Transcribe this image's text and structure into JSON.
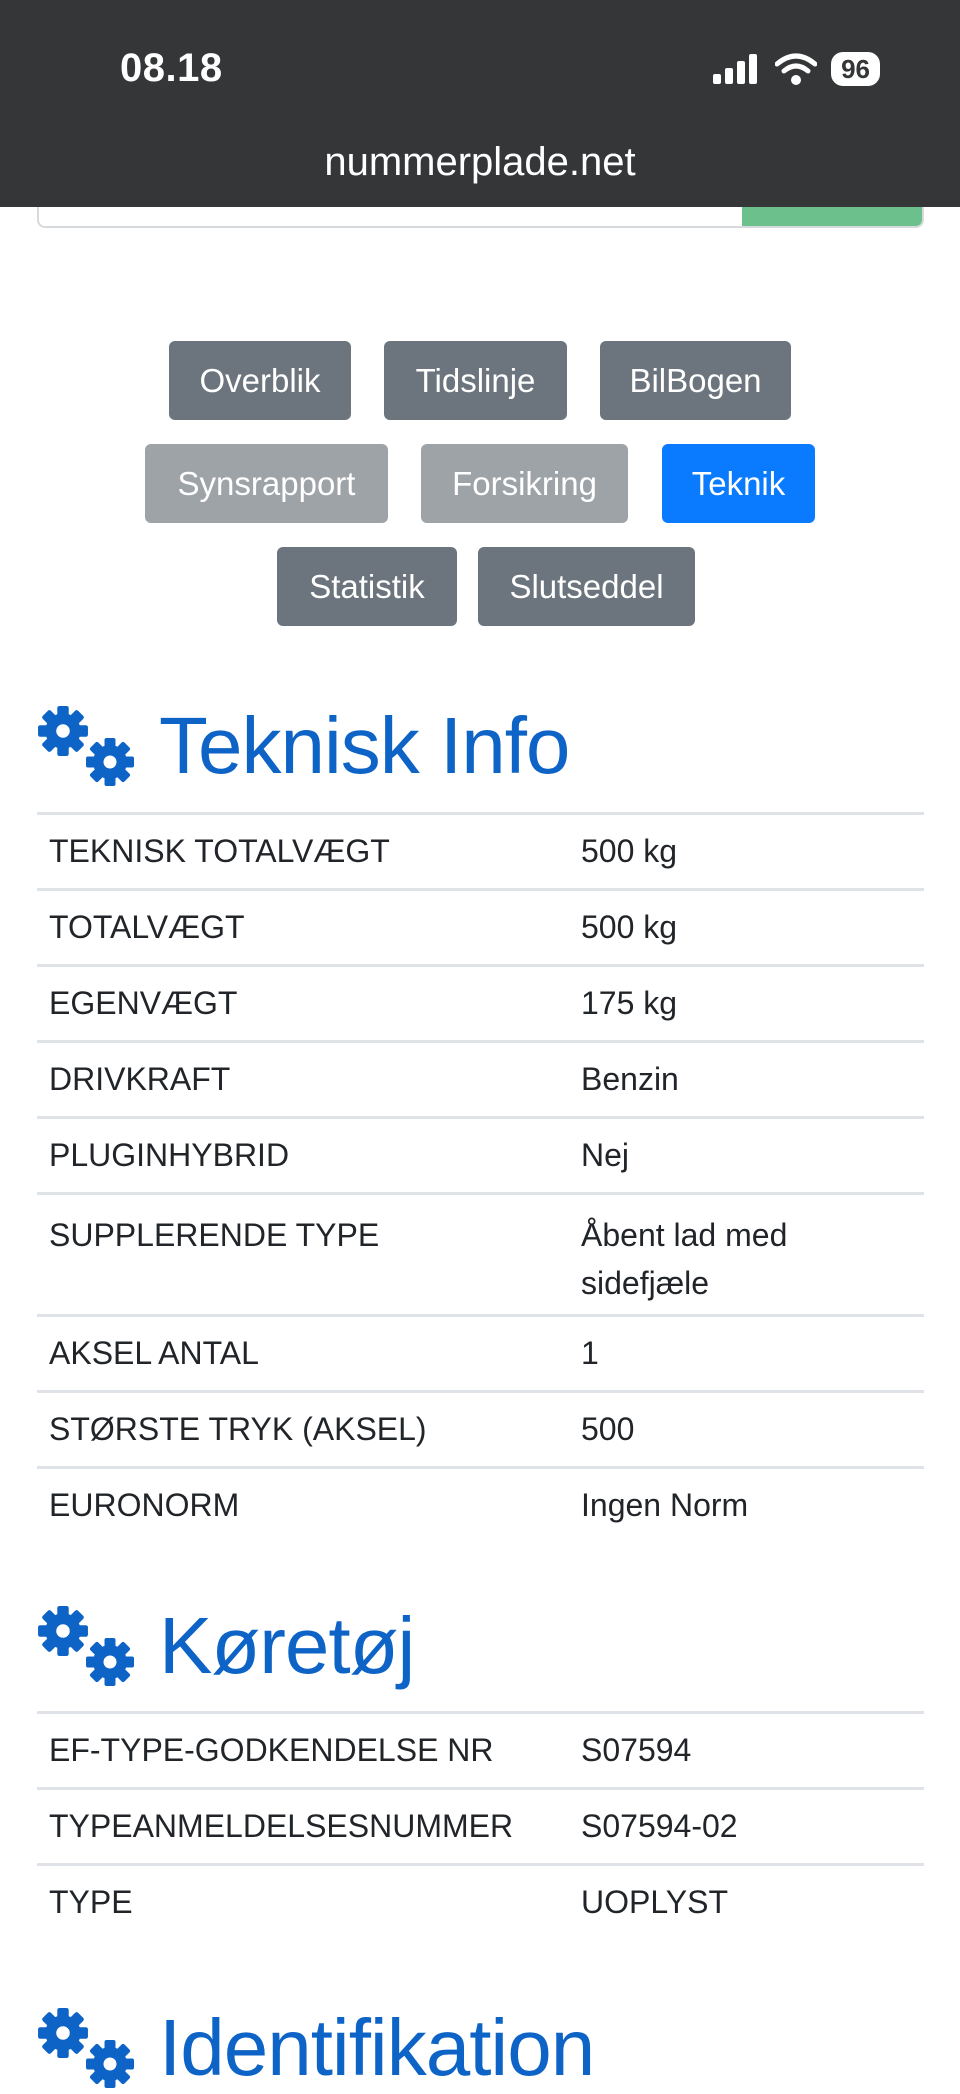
{
  "status_bar": {
    "time": "08.18",
    "battery": "96"
  },
  "browser": {
    "url": "nummerplade.net"
  },
  "nav": {
    "buttons": [
      {
        "label": "Overblik"
      },
      {
        "label": "Tidslinje"
      },
      {
        "label": "BilBogen"
      },
      {
        "label": "Synsrapport"
      },
      {
        "label": "Forsikring"
      },
      {
        "label": "Teknik"
      },
      {
        "label": "Statistik"
      },
      {
        "label": "Slutseddel"
      }
    ],
    "active": "Teknik"
  },
  "sections": {
    "teknisk": {
      "title": "Teknisk Info",
      "rows": [
        {
          "key": "TEKNISK TOTALVÆGT",
          "value": "500 kg"
        },
        {
          "key": "TOTALVÆGT",
          "value": "500 kg"
        },
        {
          "key": "EGENVÆGT",
          "value": "175 kg"
        },
        {
          "key": "DRIVKRAFT",
          "value": "Benzin"
        },
        {
          "key": "PLUGINHYBRID",
          "value": "Nej"
        },
        {
          "key": "SUPPLERENDE TYPE",
          "value": "Åbent lad med sidefjæle"
        },
        {
          "key": "AKSEL ANTAL",
          "value": "1"
        },
        {
          "key": "STØRSTE TRYK (AKSEL)",
          "value": "500"
        },
        {
          "key": "EURONORM",
          "value": "Ingen Norm"
        }
      ]
    },
    "koretoj": {
      "title": "Køretøj",
      "rows": [
        {
          "key": "EF-TYPE-GODKENDELSE NR",
          "value": "S07594"
        },
        {
          "key": "TYPEANMELDELSESNUMMER",
          "value": "S07594-02"
        },
        {
          "key": "TYPE",
          "value": "UOPLYST"
        }
      ]
    },
    "identifikation": {
      "title": "Identifikation"
    }
  },
  "icons": {
    "section_icon": "gears-icon",
    "signal": "cellular-signal-icon",
    "wifi": "wifi-icon",
    "battery": "battery-icon"
  },
  "colors": {
    "heading": "#0d63c6",
    "active_button": "#0a7bff",
    "dark_button": "#6c757d",
    "light_button": "#9ea3a8",
    "topbar": "#343638"
  }
}
